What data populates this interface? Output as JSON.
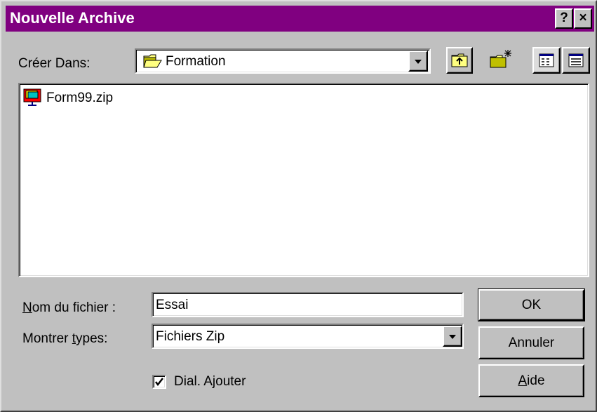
{
  "window": {
    "title": "Nouvelle Archive",
    "help_button": "?",
    "close_button": "×"
  },
  "location": {
    "label": "Créer Dans:",
    "value": "Formation"
  },
  "file_list": [
    {
      "name": "Form99.zip",
      "icon": "zip-archive-icon"
    }
  ],
  "filename": {
    "label_accel": "N",
    "label_rest": "om du fichier :",
    "value": "Essai"
  },
  "filetype": {
    "label_pre": "Montrer ",
    "label_accel": "t",
    "label_rest": "ypes:",
    "value": "Fichiers Zip"
  },
  "checkbox": {
    "label": "Dial. Ajouter",
    "checked": true
  },
  "buttons": {
    "ok": "OK",
    "cancel": "Annuler",
    "help_accel": "A",
    "help_rest": "ide"
  },
  "colors": {
    "titlebar": "#800080",
    "face": "#c0c0c0",
    "folder": "#ffff80"
  }
}
